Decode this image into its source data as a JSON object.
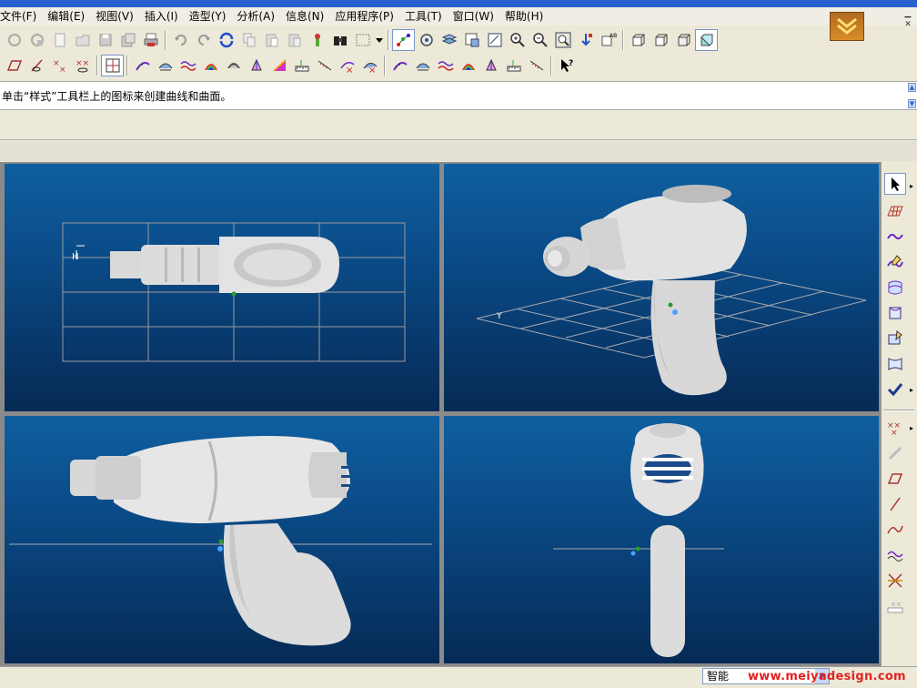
{
  "menubar": {
    "items": [
      {
        "label": "文件(F)"
      },
      {
        "label": "编辑(E)"
      },
      {
        "label": "视图(V)"
      },
      {
        "label": "插入(I)"
      },
      {
        "label": "造型(Y)"
      },
      {
        "label": "分析(A)"
      },
      {
        "label": "信息(N)"
      },
      {
        "label": "应用程序(P)"
      },
      {
        "label": "工具(T)"
      },
      {
        "label": "窗口(W)"
      },
      {
        "label": "帮助(H)"
      }
    ]
  },
  "toolbar_icons": {
    "row1": [
      "new-icon",
      "open-icon",
      "blank-icon",
      "folder-icon",
      "save-icon",
      "save-as-icon",
      "print-icon",
      "undo-icon",
      "redo-icon",
      "refresh-icon",
      "copy-icon",
      "paste-icon",
      "paste-special-icon",
      "sketch-icon",
      "binoculars-icon",
      "selection-box-icon",
      "dropdown-icon",
      "snap-point-icon",
      "rotate-view-icon",
      "layers-icon",
      "fit-view-icon",
      "zoom-window-icon",
      "zoom-in-icon",
      "zoom-out-icon",
      "zoom-fit-icon",
      "pan-icon",
      "orient-view-icon",
      "box-view-1-icon",
      "box-view-2-icon",
      "box-view-3-icon",
      "shaded-box-icon"
    ],
    "row2": [
      "plane-icon",
      "curve-eye-icon",
      "point-cross-icon",
      "point-eye-icon",
      "grid-view-icon",
      "curve-analysis-icon",
      "surface-analysis-icon",
      "wave-icon",
      "color-map-icon",
      "surface-shade-icon",
      "draft-icon",
      "highlight-icon",
      "ruler-icon",
      "section-cut-icon",
      "deviation-icon",
      "deviation-x-icon",
      "curve-analysis-2-icon",
      "surface-analysis-2-icon",
      "wave-2-icon",
      "color-map-2-icon",
      "draft-2-icon",
      "ruler-2-icon",
      "section-2-icon",
      "help-pointer-icon"
    ]
  },
  "cue_line": {
    "message": "单击“样式”工具栏上的图标来创建曲线和曲面。"
  },
  "viewports": {
    "top_view_label": "H",
    "iso_view_label": "Y"
  },
  "right_toolbar": {
    "icons": [
      "select-arrow-icon",
      "plane-grid-icon",
      "curve-icon",
      "edit-curve-icon",
      "surface-icon",
      "boundary-surface-icon",
      "edit-surface-icon",
      "blend-surface-icon",
      "checkmark-icon",
      "points-icon",
      "link-icon",
      "rectangle-icon",
      "line-icon",
      "spline-icon",
      "wave-spline-icon",
      "intersect-icon",
      "ruler-grid-icon"
    ]
  },
  "statusbar": {
    "filter_value": "智能",
    "watermark": "www.meiyadesign.com"
  },
  "colors": {
    "viewport_top": "#0f5fa0",
    "viewport_bottom": "#062a55",
    "accent_blue": "#2a5fd0",
    "watermark_red": "#e0231f"
  }
}
